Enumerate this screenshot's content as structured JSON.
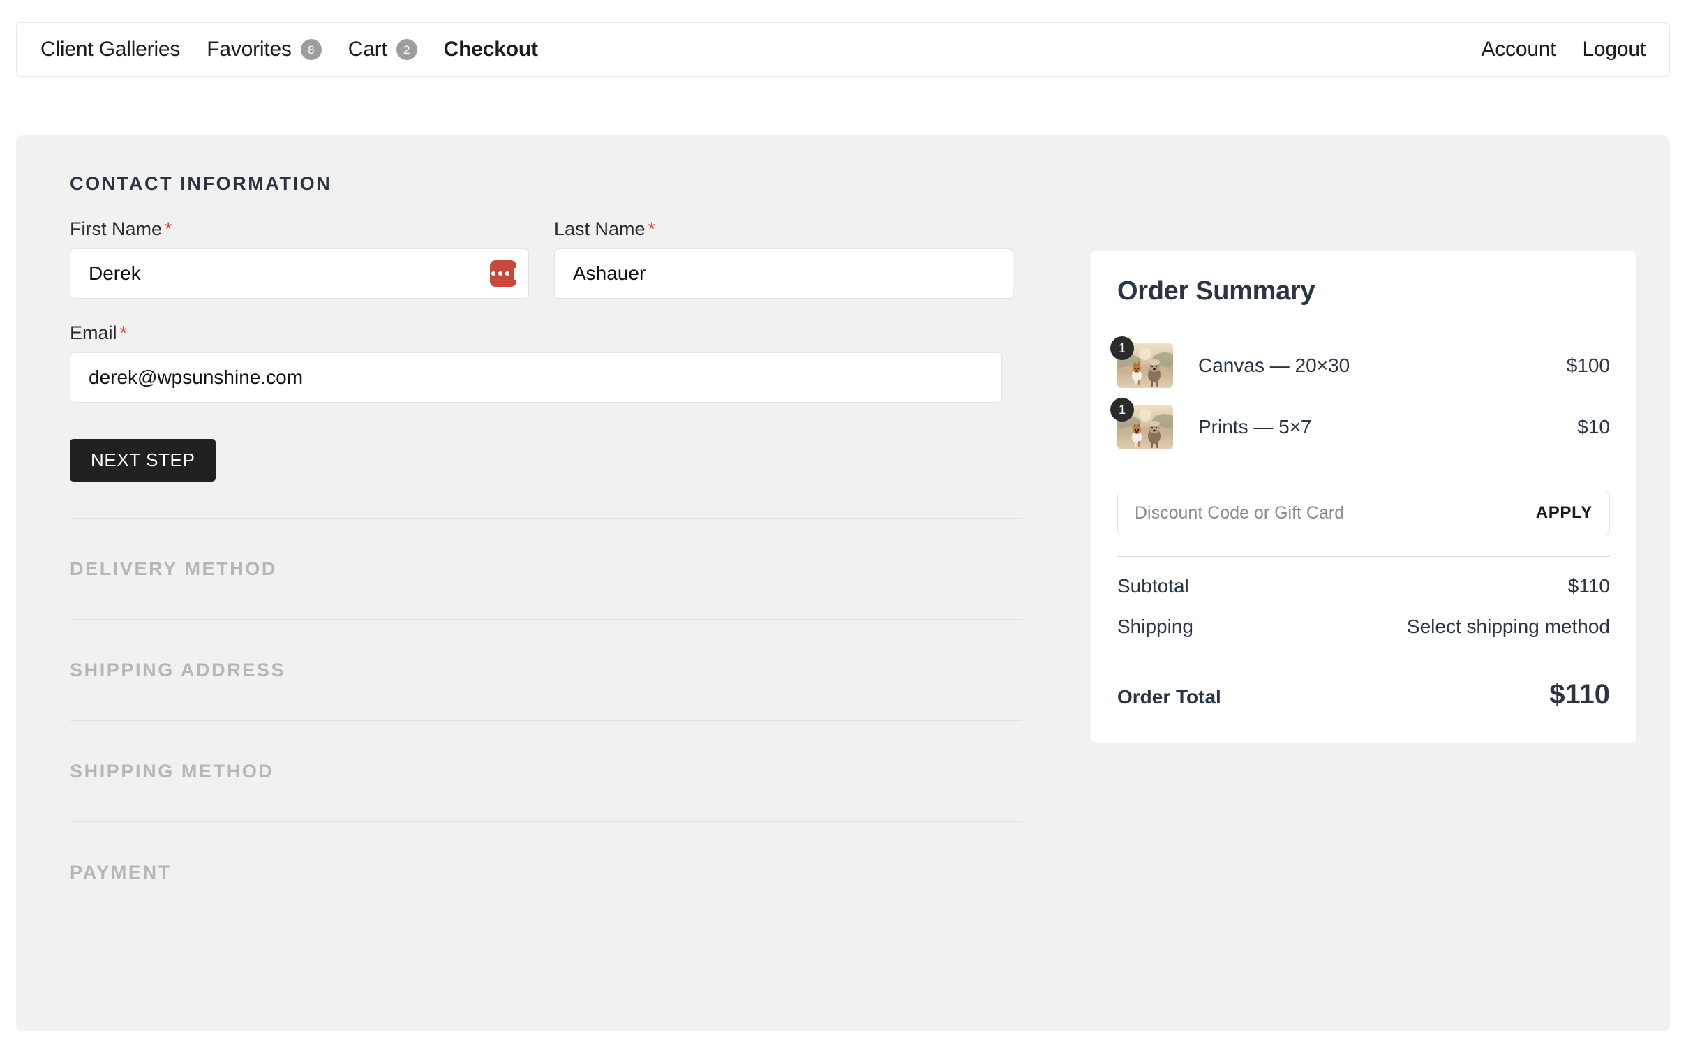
{
  "nav": {
    "left_items": [
      {
        "label": "Client Galleries",
        "badge": null,
        "active": false
      },
      {
        "label": "Favorites",
        "badge": "8",
        "active": false
      },
      {
        "label": "Cart",
        "badge": "2",
        "active": false
      },
      {
        "label": "Checkout",
        "badge": null,
        "active": true
      }
    ],
    "right_items": [
      {
        "label": "Account"
      },
      {
        "label": "Logout"
      }
    ],
    "badge_color": "#9d9d9d"
  },
  "checkout": {
    "contact": {
      "title": "Contact Information",
      "first_name": {
        "label": "First Name",
        "required_mark": "*",
        "value": "Derek",
        "placeholder": ""
      },
      "last_name": {
        "label": "Last Name",
        "required_mark": "*",
        "value": "Ashauer",
        "placeholder": ""
      },
      "email": {
        "label": "Email",
        "required_mark": "*",
        "value": "derek@wpsunshine.com",
        "placeholder": ""
      },
      "next_step_label": "NEXT STEP",
      "autofill_icon": "lastpass-icon",
      "autofill_color": "#c9483c"
    },
    "collapsed_sections": [
      {
        "title": "Delivery Method"
      },
      {
        "title": "Shipping Address"
      },
      {
        "title": "Shipping Method"
      },
      {
        "title": "Payment"
      }
    ]
  },
  "order_summary": {
    "title": "Order Summary",
    "items": [
      {
        "qty": "1",
        "name": "Canvas — 20×30",
        "price": "$100",
        "thumb": "dogs-running-photo"
      },
      {
        "qty": "1",
        "name": "Prints — 5×7",
        "price": "$10",
        "thumb": "dogs-running-photo"
      }
    ],
    "discount": {
      "placeholder": "Discount Code or Gift Card",
      "value": "",
      "apply_label": "APPLY"
    },
    "totals": [
      {
        "label": "Subtotal",
        "value": "$110"
      },
      {
        "label": "Shipping",
        "value": "Select shipping method"
      }
    ],
    "grand_total": {
      "label": "Order Total",
      "value": "$110"
    }
  }
}
